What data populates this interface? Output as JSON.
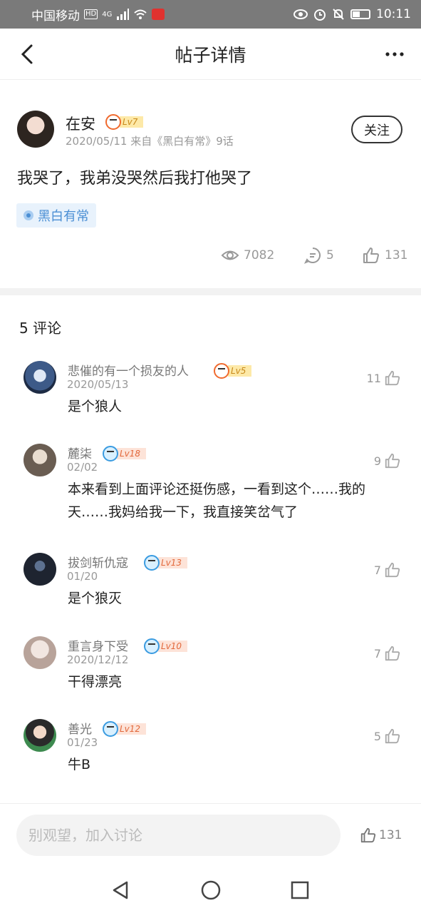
{
  "status_bar": {
    "carrier": "中国移动",
    "network": "4G",
    "hd": "HD",
    "time": "10:11"
  },
  "header": {
    "title": "帖子详情"
  },
  "post": {
    "author": {
      "name": "在安",
      "level": "Lv7"
    },
    "meta": "2020/05/11  来自《黑白有常》9话",
    "follow_label": "关注",
    "content": "我哭了，我弟没哭然后我打他哭了",
    "topic": "黑白有常",
    "stats": {
      "views": "7082",
      "comments": "5",
      "likes": "131"
    }
  },
  "comments": {
    "count_label": "5 评论",
    "items": [
      {
        "name": "悲催的有一个损友的人",
        "level": "Lv5",
        "date": "2020/05/13",
        "text": "是个狼人",
        "likes": "11"
      },
      {
        "name": "麓柒",
        "level": "Lv18",
        "date": "02/02",
        "text": "本来看到上面评论还挺伤感，一看到这个……我的天……我妈给我一下，我直接笑岔气了",
        "likes": "9"
      },
      {
        "name": "拔剑斩仇寇",
        "level": "Lv13",
        "date": "01/20",
        "text": "是个狼灭",
        "likes": "7"
      },
      {
        "name": "重言身下受",
        "level": "Lv10",
        "date": "2020/12/12",
        "text": "干得漂亮",
        "likes": "7"
      },
      {
        "name": "善光",
        "level": "Lv12",
        "date": "01/23",
        "text": "牛B",
        "likes": "5"
      }
    ]
  },
  "bottom_bar": {
    "input_placeholder": "别观望，加入讨论",
    "likes": "131"
  },
  "colors": {
    "status_bar_bg": "#7a7a7a",
    "topic_blue": "#4b8fd4",
    "level_gold": "#c8891a",
    "level_pink": "#e2693c"
  }
}
